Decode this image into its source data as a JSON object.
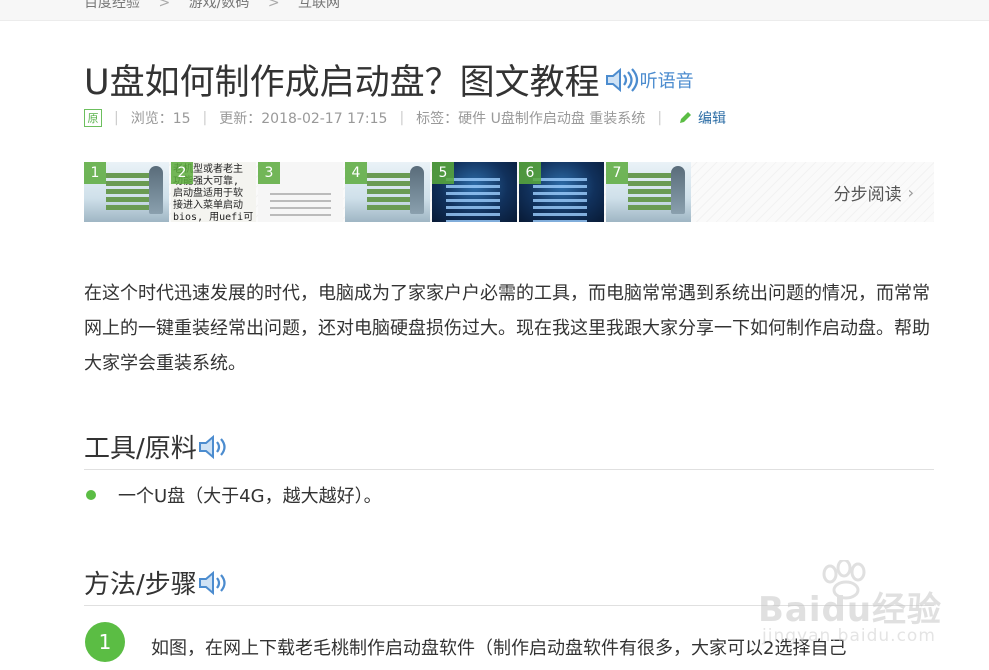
{
  "breadcrumb": [
    "百度经验",
    "游戏/数码",
    "互联网"
  ],
  "title": "U盘如何制作成启动盘？图文教程",
  "listen_label": "听语音",
  "meta": {
    "original_badge": "原",
    "views": "浏览：15",
    "updated": "更新：2018-02-17 17:15",
    "tags": "标签：硬件 U盘制作启动盘 重装系统",
    "edit": "编辑"
  },
  "thumbnails": {
    "numbers": [
      "1",
      "2",
      "3",
      "4",
      "5",
      "6",
      "7"
    ],
    "thumb2_text": "老机型或者老主\n功能强大可靠,\n启动盘适用于软\n接进入菜单启动\nbios, 用uefi可\n相信大家现在对",
    "step_read": "分步阅读"
  },
  "intro": "在这个时代迅速发展的时代，电脑成为了家家户户必需的工具，而电脑常常遇到系统出问题的情况，而常常网上的一键重装经常出问题，还对电脑硬盘损伤过大。现在我这里我跟大家分享一下如何制作启动盘。帮助大家学会重装系统。",
  "tools": {
    "heading": "工具/原料",
    "items": [
      "一个U盘（大于4G，越大越好）。"
    ]
  },
  "steps": {
    "heading": "方法/步骤",
    "items": [
      {
        "num": "1",
        "text": "如图，在网上下载老毛桃制作启动盘软件（制作启动盘软件有很多，大家可以2选择自己"
      }
    ]
  },
  "watermark": {
    "brand": "Baidu经验",
    "url": "jingyan.baidu.com"
  },
  "colors": {
    "accent_green": "#5bbd44",
    "link_blue": "#2d6ea6",
    "speaker_blue": "#4c8ccf"
  }
}
